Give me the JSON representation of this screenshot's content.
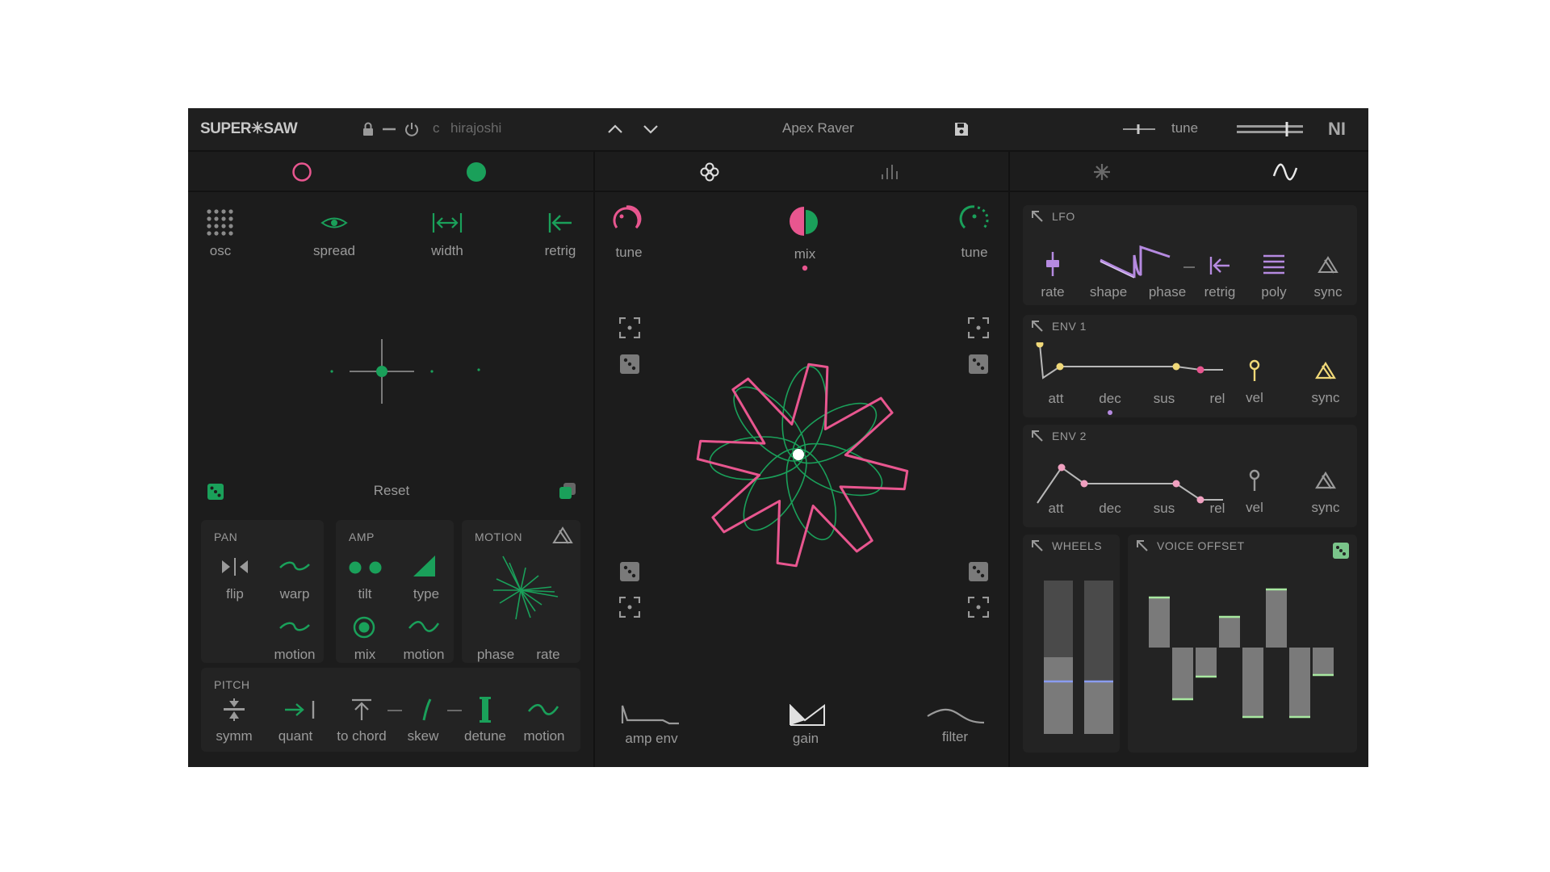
{
  "app": {
    "logo": "SUPER✳SAW",
    "brand": "NI"
  },
  "header": {
    "scale_root": "c",
    "scale_name": "hirajoshi",
    "preset_name": "Apex Raver",
    "tune_label": "tune"
  },
  "colors": {
    "bg": "#1c1c1c",
    "green": "#1aa05a",
    "pink": "#e8568f",
    "lavender": "#b58ae0",
    "yellow": "#f0d878"
  },
  "osc_panel": {
    "controls": [
      "osc",
      "spread",
      "width",
      "retrig"
    ],
    "reset_label": "Reset",
    "pan": {
      "title": "PAN",
      "items": [
        "flip",
        "warp",
        "motion"
      ]
    },
    "amp": {
      "title": "AMP",
      "items": [
        "tilt",
        "type",
        "mix",
        "motion"
      ]
    },
    "motion": {
      "title": "MOTION",
      "items": [
        "phase",
        "rate"
      ]
    },
    "pitch": {
      "title": "PITCH",
      "items": [
        "symm",
        "quant",
        "to chord",
        "skew",
        "detune",
        "motion"
      ]
    }
  },
  "mix_panel": {
    "tune_left": "tune",
    "mix": "mix",
    "tune_right": "tune",
    "bottom": [
      "amp env",
      "gain",
      "filter"
    ]
  },
  "mod_panel": {
    "lfo": {
      "title": "LFO",
      "items": [
        "rate",
        "shape",
        "phase",
        "retrig",
        "poly",
        "sync"
      ]
    },
    "env1": {
      "title": "ENV 1",
      "items": [
        "att",
        "dec",
        "sus",
        "rel",
        "vel",
        "sync"
      ]
    },
    "env2": {
      "title": "ENV 2",
      "items": [
        "att",
        "dec",
        "sus",
        "rel",
        "vel",
        "sync"
      ]
    },
    "wheels": {
      "title": "WHEELS"
    },
    "voice_offset": {
      "title": "VOICE OFFSET"
    }
  }
}
